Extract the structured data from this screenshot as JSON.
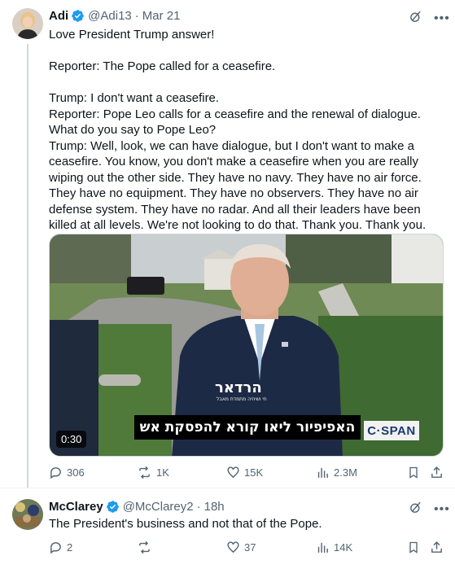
{
  "tweets": [
    {
      "name": "Adi",
      "handle": "@Adi13",
      "separator": "·",
      "date": "Mar 21",
      "text": "Love President Trump answer!\n\nReporter: The Pope called for a ceasefire.\n\nTrump: I don't want a ceasefire.\nReporter: Pope Leo calls for a ceasefire and the renewal of dialogue. What do you say to Pope Leo?\nTrump: Well, look, we can have dialogue, but I don't want to make a ceasefire. You know, you don't make a ceasefire when you are really wiping out the other side. They have no navy. They have no air force. They have no equipment. They have no observers. They have no air defense system. They have no radar. And all their leaders have been killed at all levels. We're not looking to do that. Thank you. Thank you.",
      "video": {
        "duration": "0:30",
        "subtitle": "האפיפיור ליאו קורא להפסקת אש",
        "channel_logo": "C·SPAN",
        "watermark": "הרדאר",
        "watermark_sub": "חי ושיחיה מתמדת מאבל"
      },
      "stats": {
        "replies": "306",
        "reposts": "1K",
        "likes": "15K",
        "views": "2.3M"
      }
    },
    {
      "name": "McClarey",
      "handle": "@McClarey2",
      "separator": "·",
      "date": "18h",
      "text": "The President's business and not that of the Pope.",
      "stats": {
        "replies": "2",
        "reposts": "",
        "likes": "37",
        "views": "14K"
      }
    }
  ],
  "icons": {
    "verified": "verified-badge-icon",
    "grok": "grok-icon",
    "more": "more-icon",
    "reply": "reply-icon",
    "repost": "repost-icon",
    "like": "like-icon",
    "views": "views-icon",
    "bookmark": "bookmark-icon",
    "share": "share-icon"
  },
  "colors": {
    "verified": "#1d9bf0",
    "muted": "#536471",
    "text": "#0f1419",
    "border": "#cfd9de"
  }
}
